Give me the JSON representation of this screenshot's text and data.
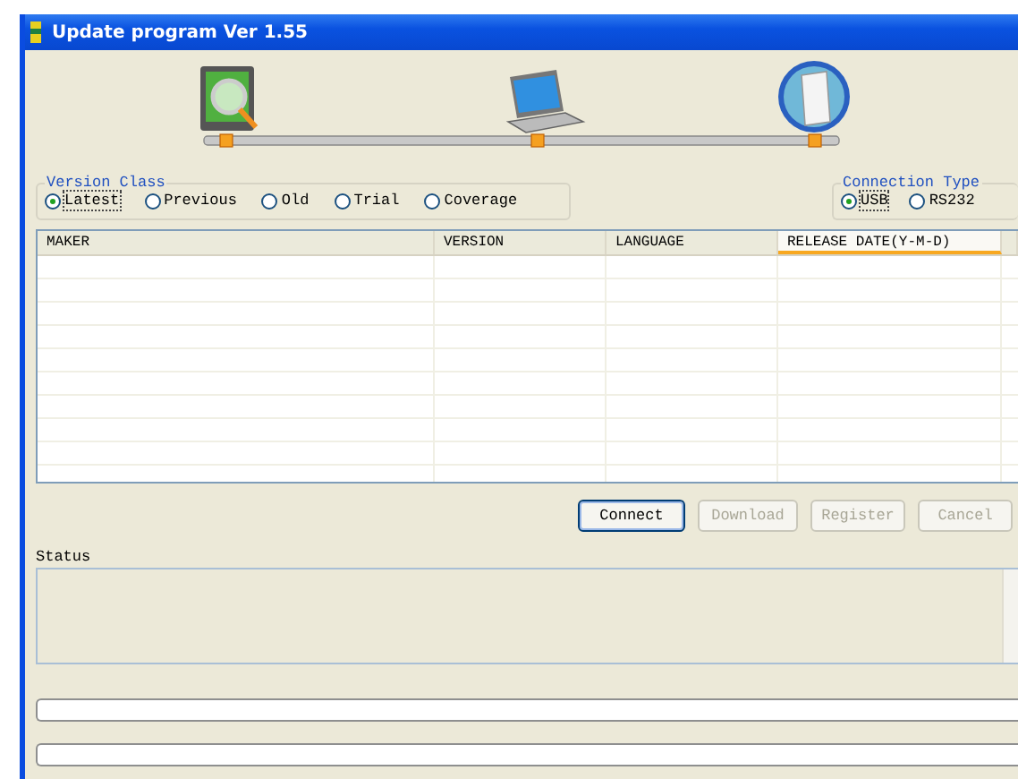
{
  "window": {
    "title": "Update program Ver 1.55"
  },
  "version_class": {
    "label": "Version Class",
    "options": [
      {
        "label": "Latest",
        "selected": true
      },
      {
        "label": "Previous",
        "selected": false
      },
      {
        "label": "Old",
        "selected": false
      },
      {
        "label": "Trial",
        "selected": false
      },
      {
        "label": "Coverage",
        "selected": false
      }
    ]
  },
  "connection_type": {
    "label": "Connection Type",
    "options": [
      {
        "label": "USB",
        "selected": true
      },
      {
        "label": "RS232",
        "selected": false
      }
    ]
  },
  "table": {
    "columns": [
      {
        "label": "MAKER",
        "selected": false
      },
      {
        "label": "VERSION",
        "selected": false
      },
      {
        "label": "LANGUAGE",
        "selected": false
      },
      {
        "label": "RELEASE DATE(Y-M-D)",
        "selected": true
      }
    ]
  },
  "buttons": [
    {
      "label": "Connect",
      "disabled": false
    },
    {
      "label": "Download",
      "disabled": true
    },
    {
      "label": "Register",
      "disabled": true
    },
    {
      "label": "Cancel",
      "disabled": true
    }
  ],
  "status": {
    "label": "Status"
  },
  "progress_bars": [
    {
      "level": 0
    },
    {
      "level": 0
    }
  ]
}
